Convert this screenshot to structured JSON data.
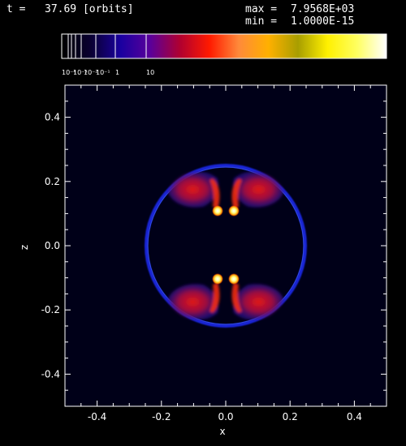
{
  "header": {
    "time_label": "t =",
    "time_value": "37.69 [orbits]",
    "max_label": "max =",
    "max_value": "7.9568E+03",
    "min_label": "min =",
    "min_value": "1.0000E-15"
  },
  "colorbar": {
    "tick_labels": [
      "10⁻⁴",
      "10⁻³",
      "10⁻²",
      "10⁻¹",
      "1",
      "10"
    ],
    "colors": [
      "#000000",
      "#0a0032",
      "#1a00a0",
      "#5a009a",
      "#b00030",
      "#ff1a00",
      "#ff8a3a",
      "#ffb000",
      "#a89e00",
      "#fff000",
      "#ffff60",
      "#ffffff"
    ]
  },
  "plot": {
    "xlabel": "x",
    "ylabel": "z",
    "xlim": [
      -0.5,
      0.5
    ],
    "ylim": [
      -0.5,
      0.5
    ],
    "xticks": [
      "-0.4",
      "-0.2",
      "0.0",
      "0.2",
      "0.4"
    ],
    "yticks": [
      "-0.4",
      "-0.2",
      "0.0",
      "0.2",
      "0.4"
    ],
    "background": "#000018",
    "shell_color": "#2233ff",
    "lobe_color": "#c01020",
    "core_color": "#ffffc0"
  }
}
